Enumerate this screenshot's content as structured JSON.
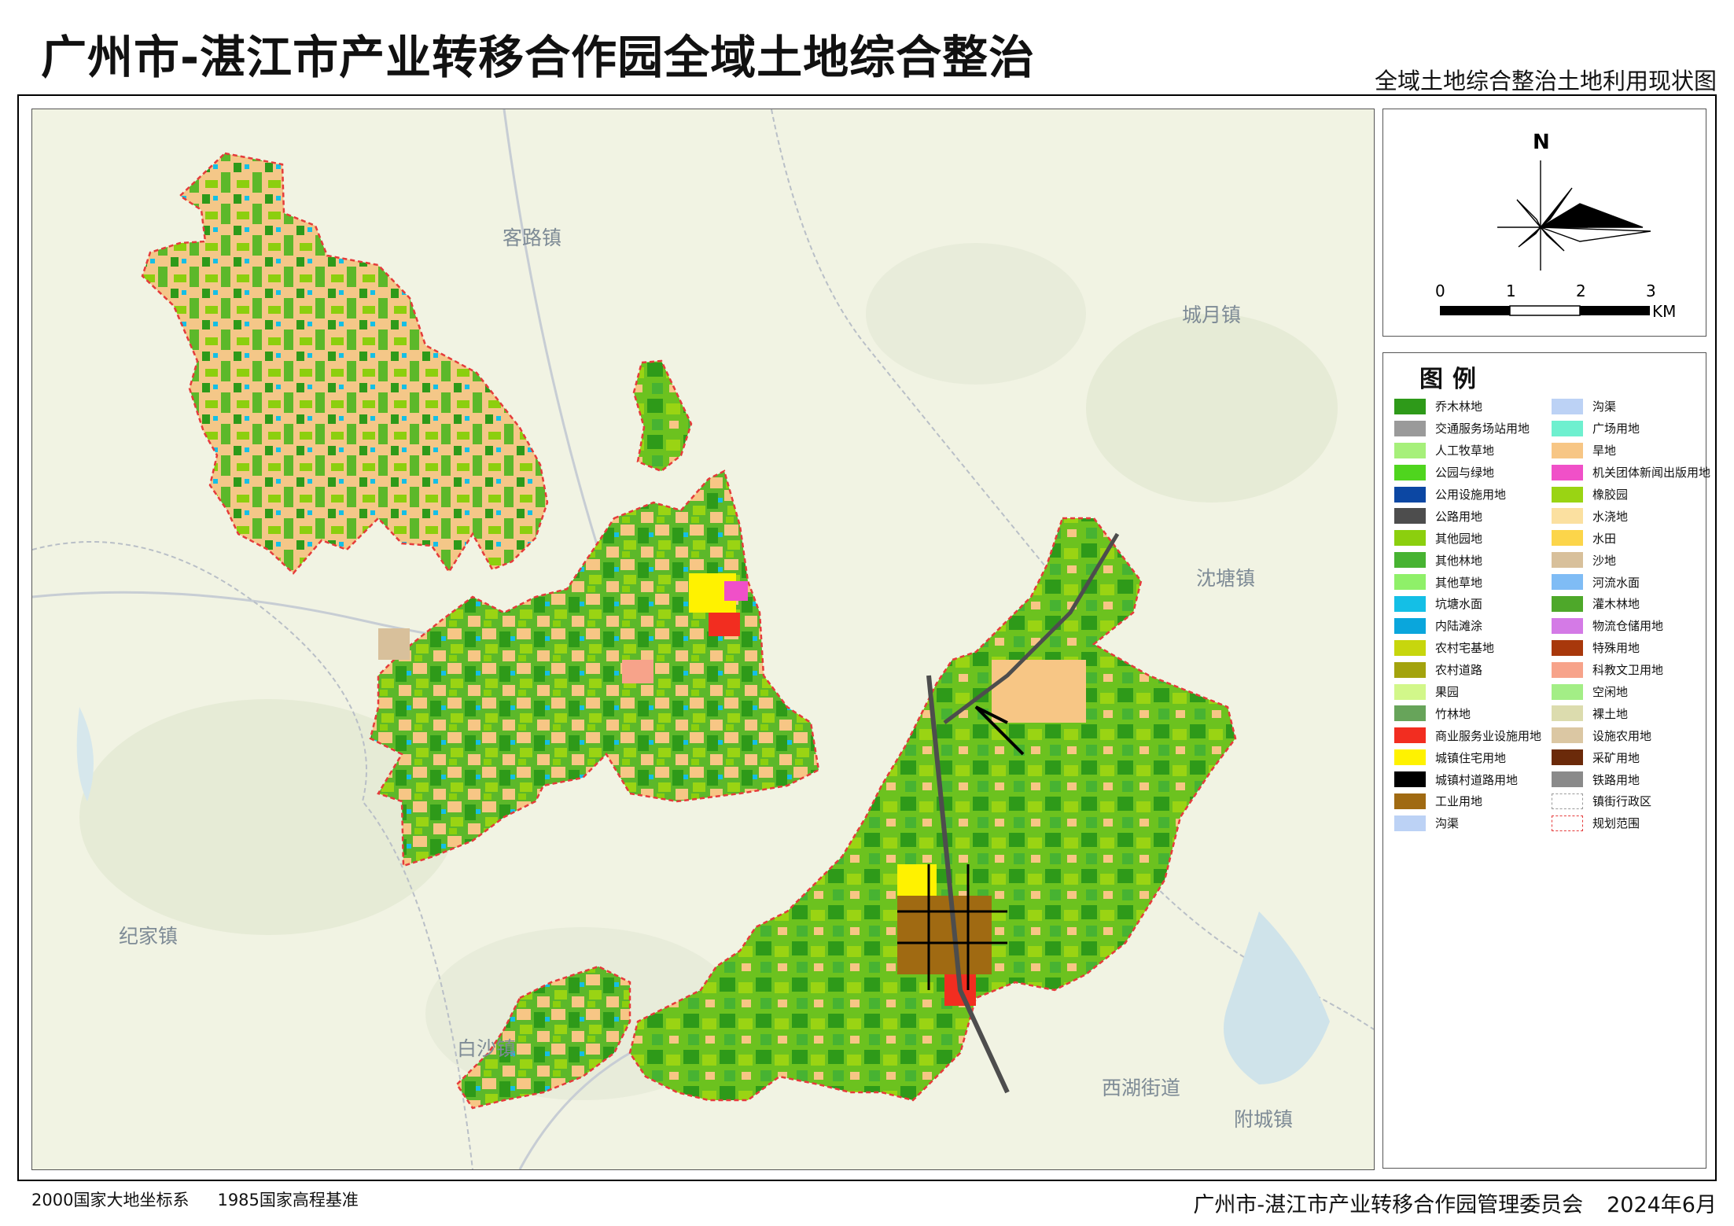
{
  "header": {
    "title": "广州市-湛江市产业转移合作园全域土地综合整治",
    "subtitle": "全域土地综合整治土地利用现状图"
  },
  "map": {
    "towns": [
      {
        "name": "客路镇"
      },
      {
        "name": "城月镇"
      },
      {
        "name": "沈塘镇"
      },
      {
        "name": "纪家镇"
      },
      {
        "name": "白沙镇"
      },
      {
        "name": "西湖街道"
      },
      {
        "name": "附城镇"
      }
    ]
  },
  "compass": {
    "north_label": "N"
  },
  "scalebar": {
    "labels": [
      "0",
      "1",
      "2",
      "3"
    ],
    "unit": "KM"
  },
  "legend": {
    "title": "图例",
    "column1": [
      {
        "label": "乔木林地",
        "color": "#2e9a19"
      },
      {
        "label": "交通服务场站用地",
        "color": "#9a9a9a"
      },
      {
        "label": "人工牧草地",
        "color": "#a6f07a"
      },
      {
        "label": "公园与绿地",
        "color": "#4fd51e"
      },
      {
        "label": "公用设施用地",
        "color": "#0c47a3"
      },
      {
        "label": "公路用地",
        "color": "#4d4d4d"
      },
      {
        "label": "其他园地",
        "color": "#8ccf0e"
      },
      {
        "label": "其他林地",
        "color": "#47b332"
      },
      {
        "label": "其他草地",
        "color": "#8ff069"
      },
      {
        "label": "坑塘水面",
        "color": "#14bfe6"
      },
      {
        "label": "内陆滩涂",
        "color": "#0aa6dc"
      },
      {
        "label": "农村宅基地",
        "color": "#c7d60d"
      },
      {
        "label": "农村道路",
        "color": "#a3a30d"
      },
      {
        "label": "果园",
        "color": "#d2f78a"
      },
      {
        "label": "竹林地",
        "color": "#67a45a"
      },
      {
        "label": "商业服务业设施用地",
        "color": "#f22d20"
      },
      {
        "label": "城镇住宅用地",
        "color": "#fff200"
      },
      {
        "label": "城镇村道路用地",
        "color": "#000000"
      },
      {
        "label": "工业用地",
        "color": "#a06a12"
      },
      {
        "label": "沟渠",
        "color": "#bcd2f5"
      }
    ],
    "column2": [
      {
        "label": "沟渠",
        "color": "#bcd2f5"
      },
      {
        "label": "广场用地",
        "color": "#6ef0cf"
      },
      {
        "label": "旱地",
        "color": "#f7c685"
      },
      {
        "label": "机关团体新闻出版用地",
        "color": "#f050c8"
      },
      {
        "label": "橡胶园",
        "color": "#9ad413"
      },
      {
        "label": "水浇地",
        "color": "#fbe0a0"
      },
      {
        "label": "水田",
        "color": "#fcd54a"
      },
      {
        "label": "沙地",
        "color": "#d8c09b"
      },
      {
        "label": "河流水面",
        "color": "#7fbcf5"
      },
      {
        "label": "灌木林地",
        "color": "#4ea82a"
      },
      {
        "label": "物流仓储用地",
        "color": "#d47ae6"
      },
      {
        "label": "特殊用地",
        "color": "#a8380b"
      },
      {
        "label": "科教文卫用地",
        "color": "#f7a38a"
      },
      {
        "label": "空闲地",
        "color": "#a3ee86"
      },
      {
        "label": "裸土地",
        "color": "#dcdcae"
      },
      {
        "label": "设施农用地",
        "color": "#dbc7a3"
      },
      {
        "label": "采矿用地",
        "color": "#6b2a0a"
      },
      {
        "label": "铁路用地",
        "color": "#8a8a8a"
      },
      {
        "label": "镇街行政区",
        "color": "#ffffff",
        "border": "dashed #9a9a9a"
      },
      {
        "label": "规划范围",
        "color": "#ffffff",
        "border": "dashed #e53b3b"
      }
    ]
  },
  "footer": {
    "crs": "2000国家大地坐标系",
    "elevation": "1985国家高程基准",
    "organization": "广州市-湛江市产业转移合作园管理委员会",
    "date": "2024年6月"
  }
}
